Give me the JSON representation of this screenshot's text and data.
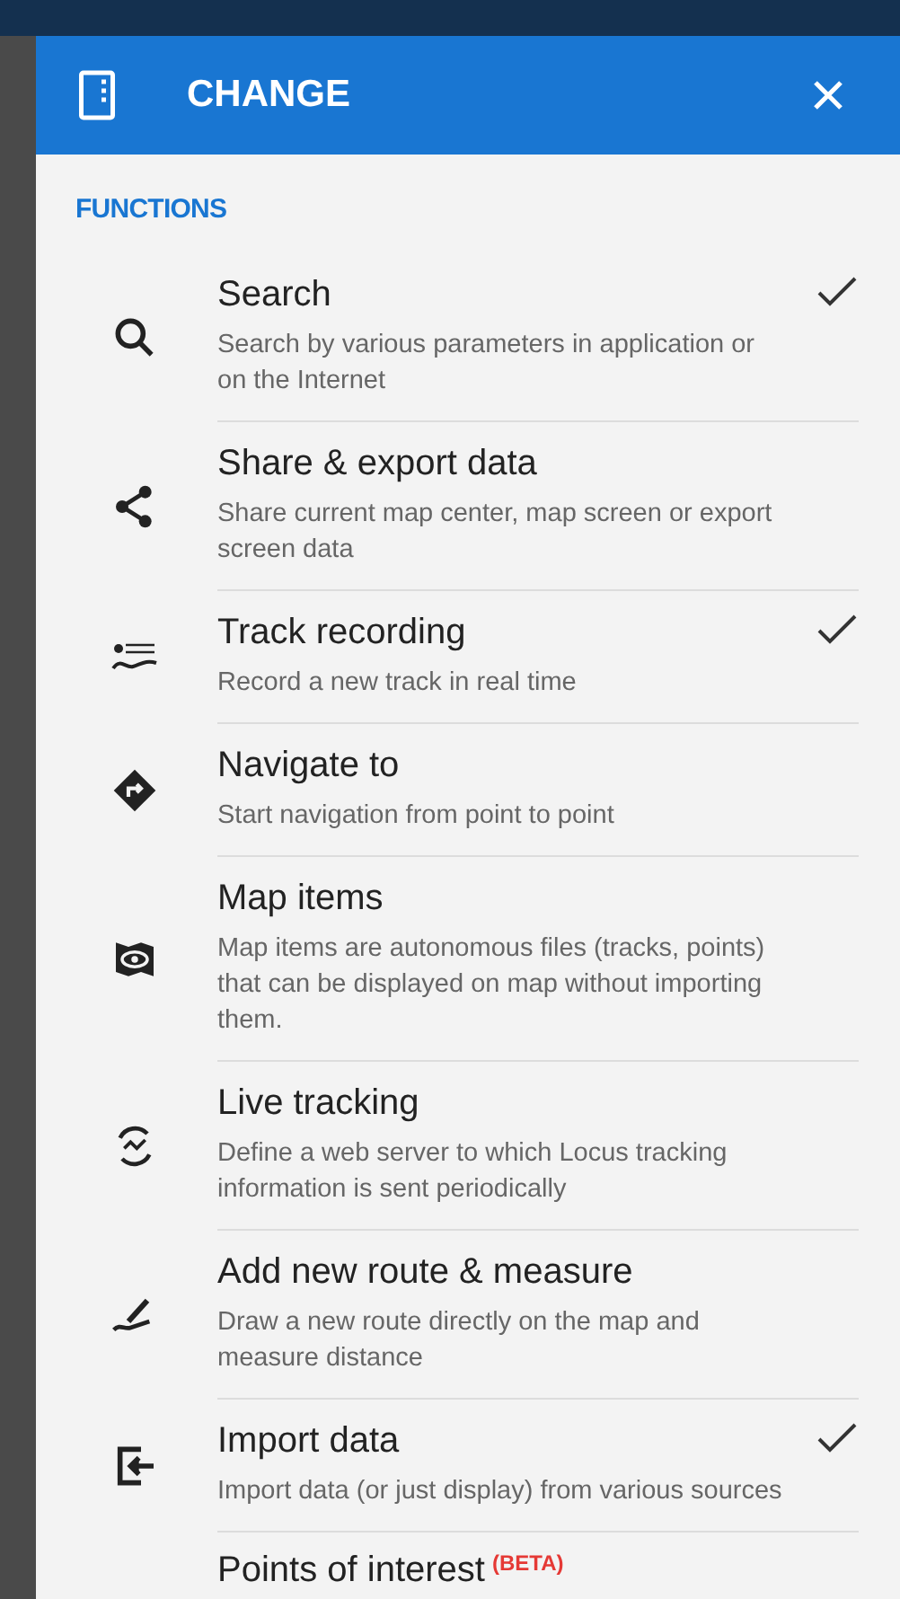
{
  "dialog": {
    "title": "CHANGE"
  },
  "section": {
    "title": "FUNCTIONS"
  },
  "items": [
    {
      "kind": "search",
      "title": "Search",
      "description": "Search by various parameters in application or on the Internet",
      "checked": true
    },
    {
      "kind": "share",
      "title": "Share & export data",
      "description": "Share current map center, map screen or export screen data",
      "checked": false
    },
    {
      "kind": "rec",
      "title": "Track recording",
      "description": "Record a new track in real time",
      "checked": true
    },
    {
      "kind": "navigate",
      "title": "Navigate to",
      "description": "Start navigation from point to point",
      "checked": false
    },
    {
      "kind": "mapitems",
      "title": "Map items",
      "description": "Map items are autonomous files (tracks, points) that can be displayed on map without importing them.",
      "checked": false
    },
    {
      "kind": "live",
      "title": "Live tracking",
      "description": "Define a web server to which Locus tracking information is sent periodically",
      "checked": false
    },
    {
      "kind": "route",
      "title": "Add new route & measure",
      "description": "Draw a new route directly on the map and measure distance",
      "checked": false
    },
    {
      "kind": "import",
      "title": "Import data",
      "description": "Import data (or just display) from various sources",
      "checked": true
    }
  ],
  "partial_item": {
    "title": "Points of interest",
    "badge": "(BETA)"
  }
}
